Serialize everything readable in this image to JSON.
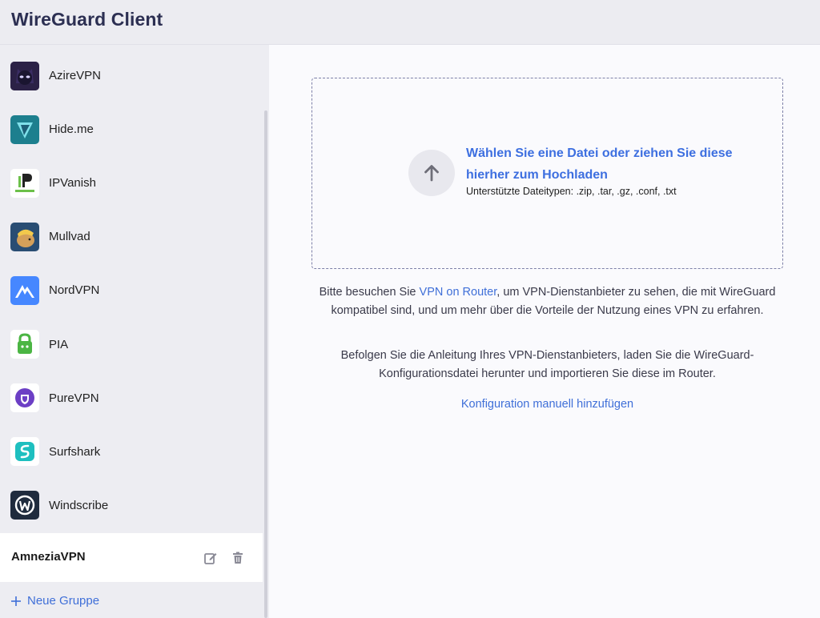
{
  "header": {
    "title": "WireGuard Client"
  },
  "sidebar": {
    "providers": [
      {
        "label": "AzireVPN",
        "icon": "azirevpn-logo-icon"
      },
      {
        "label": "Hide.me",
        "icon": "hideme-logo-icon"
      },
      {
        "label": "IPVanish",
        "icon": "ipvanish-logo-icon"
      },
      {
        "label": "Mullvad",
        "icon": "mullvad-logo-icon"
      },
      {
        "label": "NordVPN",
        "icon": "nordvpn-logo-icon"
      },
      {
        "label": "PIA",
        "icon": "pia-logo-icon"
      },
      {
        "label": "PureVPN",
        "icon": "purevpn-logo-icon"
      },
      {
        "label": "Surfshark",
        "icon": "surfshark-logo-icon"
      },
      {
        "label": "Windscribe",
        "icon": "windscribe-logo-icon"
      }
    ],
    "group": {
      "name": "AmneziaVPN"
    },
    "new_group_label": "Neue Gruppe"
  },
  "main": {
    "upload": {
      "title": "Wählen Sie eine Datei oder ziehen Sie diese hierher zum Hochladen",
      "supported_types": "Unterstützte Dateitypen: .zip, .tar, .gz, .conf, .txt"
    },
    "info1": {
      "prefix": "Bitte besuchen Sie ",
      "link": "VPN on Router",
      "suffix": ", um VPN-Dienstanbieter zu sehen, die mit WireGuard kompatibel sind, und um mehr über die Vorteile der Nutzung eines VPN zu erfahren."
    },
    "info2": "Befolgen Sie die Anleitung Ihres VPN-Dienstanbieters, laden Sie die WireGuard-Konfigurationsdatei herunter und importieren Sie diese im Router.",
    "manual_link": "Konfiguration manuell hinzufügen"
  },
  "colors": {
    "accent": "#3f6fd8",
    "header_bg": "#ececf1",
    "sidebar_bg": "#ededf2"
  }
}
